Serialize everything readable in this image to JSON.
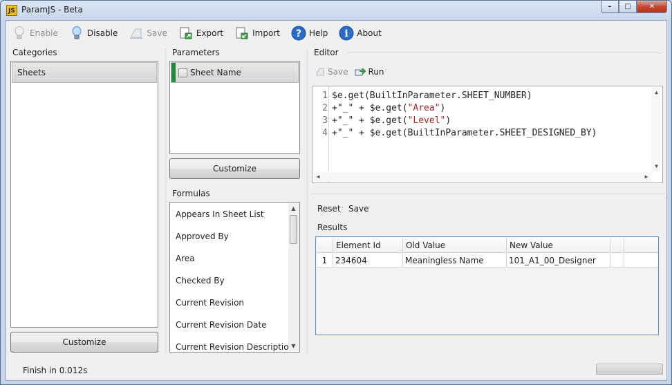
{
  "window": {
    "logo": "JS",
    "title": "ParamJS - Beta",
    "minimize": "–",
    "maximize": "□",
    "close": "✕"
  },
  "toolbar": {
    "items": [
      {
        "label": "Enable",
        "icon": "bulb-off-icon",
        "enabled": false
      },
      {
        "label": "Disable",
        "icon": "bulb-on-icon",
        "enabled": true
      },
      {
        "label": "Save",
        "icon": "save-icon",
        "enabled": false
      },
      {
        "label": "Export",
        "icon": "export-icon",
        "enabled": true
      },
      {
        "label": "Import",
        "icon": "import-icon",
        "enabled": true
      },
      {
        "label": "Help",
        "icon": "help-icon",
        "enabled": true
      },
      {
        "label": "About",
        "icon": "info-icon",
        "enabled": true
      }
    ]
  },
  "categories": {
    "label": "Categories",
    "items": [
      "Sheets"
    ],
    "selected": "Sheets",
    "customize_label": "Customize"
  },
  "parameters": {
    "label": "Parameters",
    "items": [
      {
        "name": "Sheet Name",
        "checked": false
      }
    ],
    "customize_label": "Customize"
  },
  "formulas": {
    "label": "Formulas",
    "items": [
      "Appears In Sheet List",
      "Approved By",
      "Area",
      "Checked By",
      "Current Revision",
      "Current Revision Date",
      "Current Revision Description"
    ]
  },
  "editor": {
    "label": "Editor",
    "save_label": "Save",
    "run_label": "Run",
    "lines": [
      {
        "n": "1",
        "text": "$e.get(BuiltInParameter.SHEET_NUMBER)"
      },
      {
        "n": "2",
        "pre": "+\"_\" + $e.get(",
        "str": "\"Area\"",
        "post": ")"
      },
      {
        "n": "3",
        "pre": "+\"_\" + $e.get(",
        "str": "\"Level\"",
        "post": ")"
      },
      {
        "n": "4",
        "text": "+\"_\" + $e.get(BuiltInParameter.SHEET_DESIGNED_BY)"
      }
    ]
  },
  "results": {
    "reset_label": "Reset",
    "save_label": "Save",
    "label": "Results",
    "columns": [
      "",
      "Element Id",
      "Old Value",
      "New Value",
      ""
    ],
    "rows": [
      {
        "index": "1",
        "element_id": "234604",
        "old_value": "Meaningless Name",
        "new_value": "101_A1_00_Designer"
      }
    ]
  },
  "status": {
    "text": "Finish in 0.012s",
    "progress": 0
  },
  "colors": {
    "param_marker": "#22883a",
    "string_literal": "#a3272b"
  }
}
